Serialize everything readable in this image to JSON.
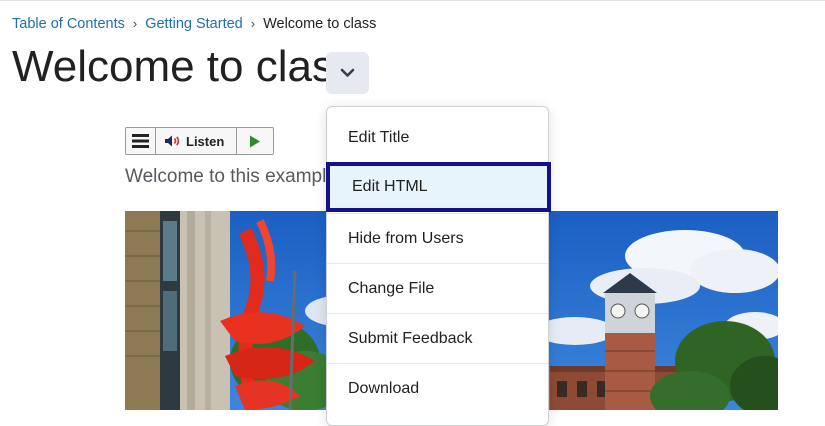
{
  "breadcrumb": {
    "items": [
      "Table of Contents",
      "Getting Started"
    ],
    "separator": "›",
    "current": "Welcome to class"
  },
  "page": {
    "title": "Welcome to class",
    "intro": "Welcome to this exampl"
  },
  "readspeaker": {
    "listen_label": "Listen"
  },
  "context_menu": {
    "items": [
      {
        "label": "Edit Title"
      },
      {
        "label": "Edit HTML",
        "focused": true
      },
      {
        "label": "Hide from Users"
      },
      {
        "label": "Change File"
      },
      {
        "label": "Submit Feedback"
      },
      {
        "label": "Download"
      }
    ]
  },
  "icons": {
    "title_menu": "chevron-down-icon",
    "rs_menu": "hamburger-menu-icon",
    "rs_listen": "speaker-icon",
    "rs_play": "play-icon"
  },
  "colors": {
    "link": "#1f6fad",
    "focus_border": "#14128a",
    "focus_bg": "#e7f4fb",
    "play_green": "#2e8b2e"
  }
}
